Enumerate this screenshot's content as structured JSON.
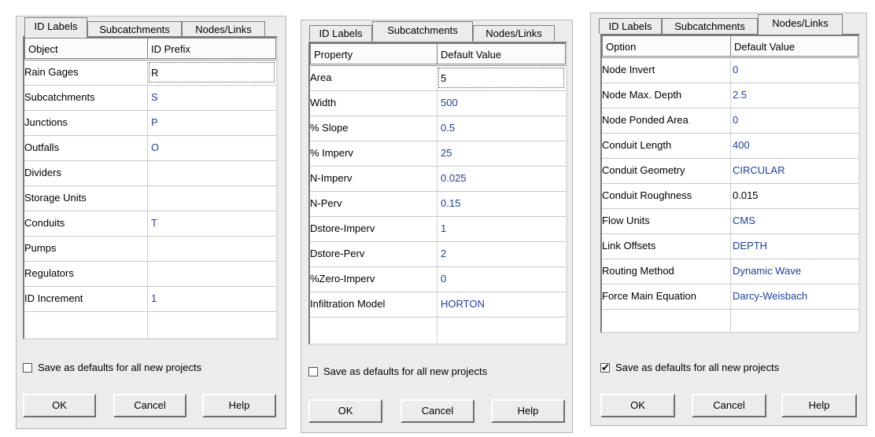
{
  "dialogs": [
    {
      "tabs": [
        "ID Labels",
        "Subcatchments",
        "Nodes/Links"
      ],
      "active_tab": 0,
      "columns": [
        "Object",
        "ID Prefix"
      ],
      "rows": [
        {
          "name": "Rain Gages",
          "value": "R"
        },
        {
          "name": "Subcatchments",
          "value": "S"
        },
        {
          "name": "Junctions",
          "value": "P"
        },
        {
          "name": "Outfalls",
          "value": "O"
        },
        {
          "name": "Dividers",
          "value": ""
        },
        {
          "name": "Storage Units",
          "value": ""
        },
        {
          "name": "Conduits",
          "value": "T"
        },
        {
          "name": "Pumps",
          "value": ""
        },
        {
          "name": "Regulators",
          "value": ""
        },
        {
          "name": "ID Increment",
          "value": "1"
        }
      ],
      "checkbox_label": "Save as defaults for all new projects",
      "checkbox_checked": false,
      "buttons": {
        "ok": "OK",
        "cancel": "Cancel",
        "help": "Help"
      }
    },
    {
      "tabs": [
        "ID Labels",
        "Subcatchments",
        "Nodes/Links"
      ],
      "active_tab": 1,
      "columns": [
        "Property",
        "Default Value"
      ],
      "rows": [
        {
          "name": "Area",
          "value": "5"
        },
        {
          "name": "Width",
          "value": "500"
        },
        {
          "name": "% Slope",
          "value": "0.5"
        },
        {
          "name": "% Imperv",
          "value": "25"
        },
        {
          "name": "N-Imperv",
          "value": "0.025"
        },
        {
          "name": "N-Perv",
          "value": "0.15"
        },
        {
          "name": "Dstore-Imperv",
          "value": "1"
        },
        {
          "name": "Dstore-Perv",
          "value": "2"
        },
        {
          "name": "%Zero-Imperv",
          "value": "0"
        },
        {
          "name": "Infiltration Model",
          "value": "HORTON"
        }
      ],
      "checkbox_label": "Save as defaults for all new projects",
      "checkbox_checked": false,
      "buttons": {
        "ok": "OK",
        "cancel": "Cancel",
        "help": "Help"
      }
    },
    {
      "tabs": [
        "ID Labels",
        "Subcatchments",
        "Nodes/Links"
      ],
      "active_tab": 2,
      "columns": [
        "Option",
        "Default Value"
      ],
      "rows": [
        {
          "name": "Node Invert",
          "value": "0"
        },
        {
          "name": "Node Max. Depth",
          "value": "2.5"
        },
        {
          "name": "Node Ponded Area",
          "value": "0"
        },
        {
          "name": "Conduit Length",
          "value": "400"
        },
        {
          "name": "Conduit Geometry",
          "value": "CIRCULAR"
        },
        {
          "name": "Conduit Roughness",
          "value": "0.015"
        },
        {
          "name": "Flow Units",
          "value": "CMS"
        },
        {
          "name": "Link Offsets",
          "value": "DEPTH"
        },
        {
          "name": "Routing Method",
          "value": "Dynamic Wave"
        },
        {
          "name": "Force Main Equation",
          "value": "Darcy-Weisbach"
        }
      ],
      "checkbox_label": "Save as defaults for all new projects",
      "checkbox_checked": true,
      "buttons": {
        "ok": "OK",
        "cancel": "Cancel",
        "help": "Help"
      }
    }
  ],
  "colors": {
    "value_text": "#1b3fa8",
    "dialog_bg": "#ececec"
  }
}
